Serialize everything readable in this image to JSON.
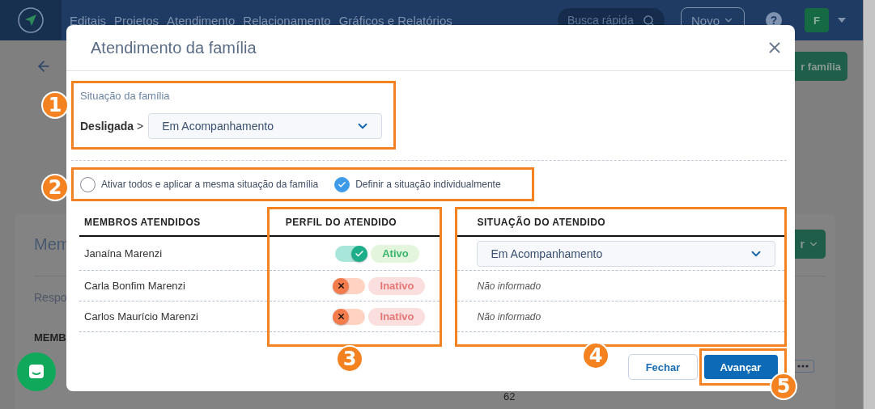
{
  "nav": {
    "items": [
      "Editais",
      "Projetos",
      "Atendimento",
      "Relacionamento",
      "Gráficos e Relatórios"
    ],
    "search": {
      "placeholder": "Busca rápida"
    },
    "new_button": "Novo",
    "help": "?",
    "avatar": "F"
  },
  "background": {
    "top_button": "r família",
    "card_title": "Mem",
    "card_button": "r",
    "label": "Respo",
    "column": "MEMB",
    "number": "62"
  },
  "modal": {
    "title": "Atendimento da família",
    "family": {
      "label": "Situação da família",
      "current": "**Desligada** >",
      "value": "Em Acompanhamento"
    },
    "options": [
      {
        "label": "Ativar todos e aplicar a mesma situação da família",
        "selected": false
      },
      {
        "label": "Definir a situação individualmente",
        "selected": true
      }
    ],
    "columns": [
      "MEMBROS ATENDIDOS",
      "PERFIL DO ATENDIDO",
      "SITUAÇÃO DO ATENDIDO"
    ],
    "rows": [
      {
        "name": "Janaína Marenzi",
        "active": true,
        "status": "Ativo",
        "situation": {
          "kind": "select",
          "value": "Em Acompanhamento"
        }
      },
      {
        "name": "Carla Bonfim Marenzi",
        "active": false,
        "status": "Inativo",
        "situation": {
          "kind": "text",
          "value": "Não informado"
        }
      },
      {
        "name": "Carlos Maurício Marenzi",
        "active": false,
        "status": "Inativo",
        "situation": {
          "kind": "text",
          "value": "Não informado"
        }
      }
    ],
    "buttons": {
      "close": "Fechar",
      "next": "Avançar"
    }
  },
  "annotations": [
    "1",
    "2",
    "3",
    "4",
    "5"
  ]
}
